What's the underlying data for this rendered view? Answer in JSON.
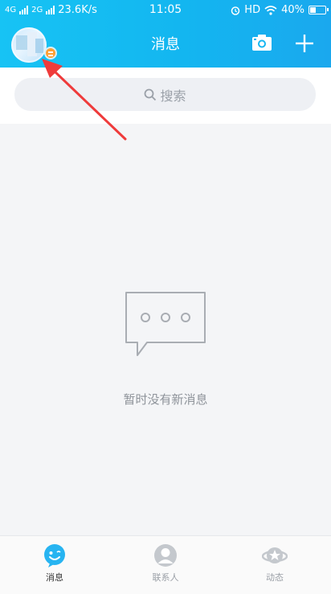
{
  "status_bar": {
    "network1": "4G",
    "network2": "2G",
    "speed": "23.6K/s",
    "time": "11:05",
    "hd": "HD",
    "battery": "40%",
    "battery_level": 0.4
  },
  "header": {
    "title": "消息"
  },
  "search": {
    "placeholder": "搜索"
  },
  "empty_state": {
    "text": "暂时没有新消息"
  },
  "bottom_nav": {
    "items": [
      {
        "label": "消息",
        "active": true
      },
      {
        "label": "联系人",
        "active": false
      },
      {
        "label": "动态",
        "active": false
      }
    ]
  },
  "colors": {
    "header_blue": "#17c3f4",
    "arrow_red": "#ef3b3b",
    "badge_orange": "#ffa033"
  },
  "icons": {
    "camera": "camera-icon",
    "plus": "plus-icon",
    "search": "search-icon",
    "empty": "chat-bubble-icon",
    "nav": [
      "smiley-chat-icon",
      "contact-person-icon",
      "star-planet-icon"
    ]
  }
}
